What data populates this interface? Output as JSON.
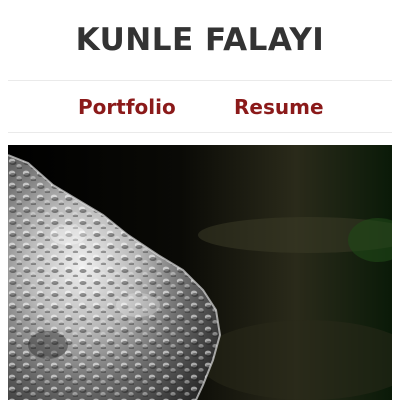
{
  "header": {
    "title": "KUNLE FALAYI"
  },
  "nav": {
    "items": [
      {
        "label": "Portfolio"
      },
      {
        "label": "Resume"
      }
    ]
  },
  "hero": {
    "image_subject": "crumpled-silver-metal-photo"
  },
  "colors": {
    "title": "#333333",
    "nav_link": "#8b1a1a",
    "divider": "#eaeaea",
    "hero_background": "#000000"
  }
}
